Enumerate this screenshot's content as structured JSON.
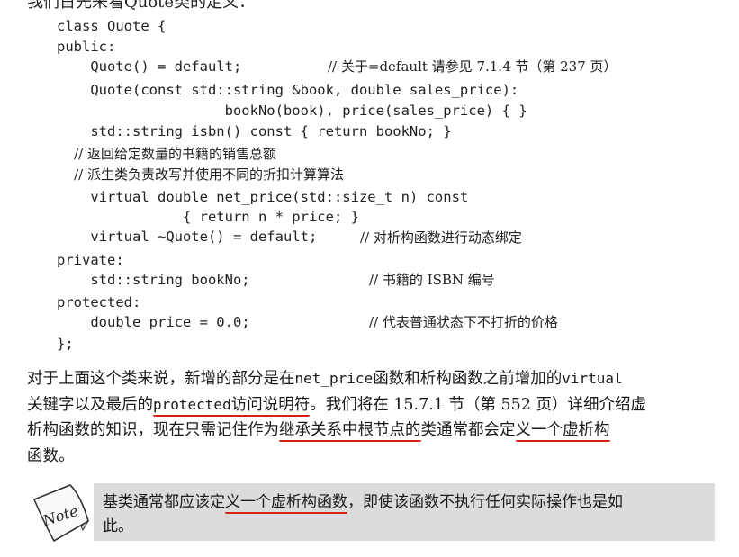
{
  "page": {
    "top_cut_text": "我们首先来看Quote类的定义："
  },
  "code_block": {
    "lines": [
      {
        "code": "class Quote {",
        "comment": ""
      },
      {
        "code": "public:",
        "comment": ""
      },
      {
        "code": "    Quote() = default;",
        "comment": "// 关于=default 请参见 7.1.4 节（第 237 页）"
      },
      {
        "code": "    Quote(const std::string &book, double sales_price):",
        "comment": ""
      },
      {
        "code": "                    bookNo(book), price(sales_price) { }",
        "comment": ""
      },
      {
        "code": "    std::string isbn() const { return bookNo; }",
        "comment": ""
      },
      {
        "code": "    // 返回给定数量的书籍的销售总额",
        "comment": ""
      },
      {
        "code": "    // 派生类负责改写并使用不同的折扣计算算法",
        "comment": ""
      },
      {
        "code": "    virtual double net_price(std::size_t n) const",
        "comment": ""
      },
      {
        "code": "               { return n * price; }",
        "comment": ""
      },
      {
        "code": "    virtual ~Quote() = default;",
        "comment": "// 对析构函数进行动态绑定"
      },
      {
        "code": "private:",
        "comment": ""
      },
      {
        "code": "    std::string bookNo;",
        "comment": "// 书籍的 ISBN 编号"
      },
      {
        "code": "protected:",
        "comment": ""
      },
      {
        "code": "    double price = 0.0;",
        "comment": "// 代表普通状态下不打折的价格"
      },
      {
        "code": "};",
        "comment": ""
      }
    ]
  },
  "paragraph": {
    "line1_a": "对于上面这个类来说，新增的部分是在",
    "line1_code1": "net_price",
    "line1_b": "函数和析构函数之前增加的",
    "line1_code2": "virtual",
    "line2_a": "关键字以及最后的",
    "line2_code": "protected",
    "line2_hl": "访问说明符",
    "line2_b": "。我们将在 15.7.1 节（第 552 页）详细介绍虚",
    "line3_a": "析构函数的知识，现在只需记住作为",
    "line3_hl1": "继承关系中根节点的",
    "line3_b": "类通常都会定",
    "line3_hl2": "义一个虚析构",
    "line4": "函数。"
  },
  "note": {
    "icon_label": "Note",
    "text_a": "基类通常都应该定",
    "text_hl": "义一个虚析构函数",
    "text_b": "，即使该函数不执行任何实际操作也是如",
    "text_line2": "此。"
  },
  "colors": {
    "underline": "#d6201a",
    "note_background": "#dcdcdc",
    "text": "#1a1a1a"
  }
}
